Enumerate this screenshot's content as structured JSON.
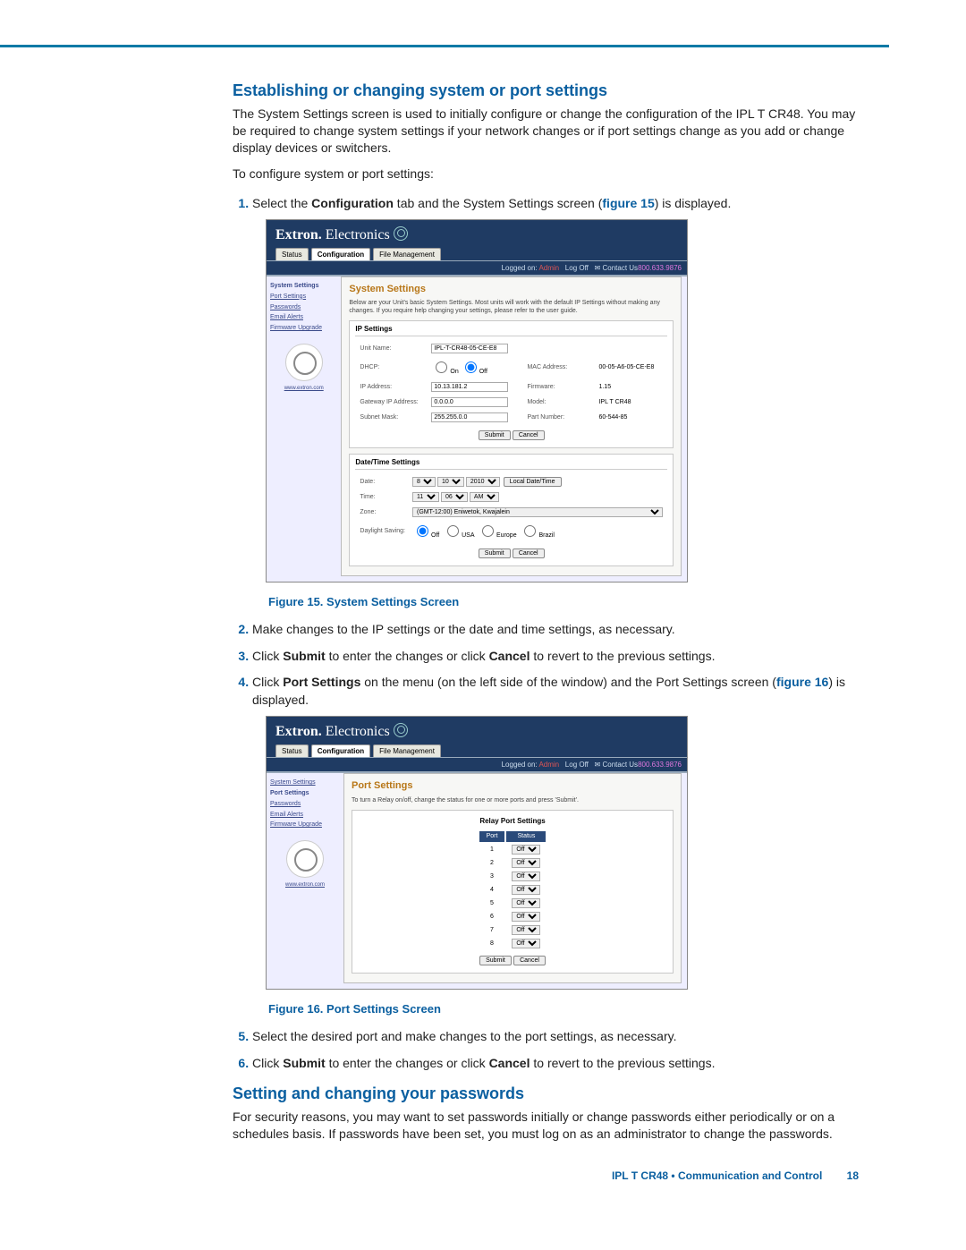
{
  "section1_title": "Establishing or changing system or port settings",
  "section1_para": "The System Settings screen is used to initially configure or change the configuration of the IPL T CR48. You may be required to change system settings if your network changes or if port settings change as you add or change display devices or switchers.",
  "section1_lead": "To configure system or port settings:",
  "step1_a": "Select the ",
  "step1_b": "Configuration",
  "step1_c": " tab and the System Settings screen (",
  "step1_d": "figure 15",
  "step1_e": ") is displayed.",
  "fig15_cap": "Figure 15. System Settings Screen",
  "step2": "Make changes to the IP settings or the date and time settings, as necessary.",
  "step3_a": "Click ",
  "step3_b": "Submit",
  "step3_c": " to enter the changes or click ",
  "step3_d": "Cancel",
  "step3_e": " to revert to the previous settings.",
  "step4_a": "Click ",
  "step4_b": "Port Settings",
  "step4_c": " on the menu (on the left side of the window) and the Port Settings screen (",
  "step4_d": "figure 16",
  "step4_e": ") is displayed.",
  "fig16_cap": "Figure 16. Port Settings Screen",
  "step5": "Select the desired port and make changes to the port settings, as necessary.",
  "step6_a": "Click ",
  "step6_b": "Submit",
  "step6_c": " to enter the changes or click ",
  "step6_d": "Cancel",
  "step6_e": " to revert to the previous settings.",
  "section2_title": "Setting and changing your passwords",
  "section2_para": "For security reasons, you may want to set passwords initially or change passwords either periodically or on a schedules basis. If passwords have been set, you must log on as an administrator to change the passwords.",
  "footer_text": "IPL T CR48 • Communication and Control",
  "footer_page": "18",
  "shot": {
    "brand1": "Extron.",
    "brand2": "Electronics",
    "tabs": {
      "status": "Status",
      "config": "Configuration",
      "file": "File Management"
    },
    "phone": "800.633.9876",
    "userbar_a": "Logged on: ",
    "userbar_b": "Admin",
    "userbar_c": "Log Off",
    "userbar_d": "Contact Us",
    "side": {
      "sys": "System Settings",
      "port": "Port Settings",
      "pass": "Passwords",
      "email": "Email Alerts",
      "fw": "Firmware Upgrade",
      "url": "www.extron.com"
    },
    "sys": {
      "title": "System Settings",
      "intro": "Below are your Unit's basic System Settings. Most units will work with the default IP Settings without making any changes. If you require help changing your settings, please refer to the user guide.",
      "ip_h": "IP Settings",
      "unit_l": "Unit Name:",
      "unit_v": "IPL-T-CR48-05-CE-E8",
      "dhcp_l": "DHCP:",
      "dhcp_on": "On",
      "dhcp_off": "Off",
      "mac_l": "MAC Address:",
      "mac_v": "00-05-A6-05-CE-E8",
      "ip_l": "IP Address:",
      "ip_v": "10.13.181.2",
      "fw_l": "Firmware:",
      "fw_v": "1.15",
      "gw_l": "Gateway IP Address:",
      "gw_v": "0.0.0.0",
      "model_l": "Model:",
      "model_v": "IPL T CR48",
      "sm_l": "Subnet Mask:",
      "sm_v": "255.255.0.0",
      "pn_l": "Part Number:",
      "pn_v": "60-544-85",
      "submit": "Submit",
      "cancel": "Cancel",
      "dt_h": "Date/Time Settings",
      "date_l": "Date:",
      "date_m": "8",
      "date_d": "10",
      "date_y": "2010",
      "localbtn": "Local Date/Time",
      "time_l": "Time:",
      "time_h": "11",
      "time_mm": "06",
      "time_ap": "AM",
      "zone_l": "Zone:",
      "zone_v": "(GMT-12:00) Eniwetok, Kwajalein",
      "dst_l": "Daylight Saving:",
      "dst_off": "Off",
      "dst_usa": "USA",
      "dst_eu": "Europe",
      "dst_br": "Brazil"
    },
    "port": {
      "title": "Port Settings",
      "intro": "To turn a Relay on/off, change the status for one or more ports and press 'Submit'.",
      "tbl_h": "Relay Port Settings",
      "col1": "Port",
      "col2": "Status",
      "off": "Off",
      "ports": [
        "1",
        "2",
        "3",
        "4",
        "5",
        "6",
        "7",
        "8"
      ],
      "submit": "Submit",
      "cancel": "Cancel"
    }
  }
}
